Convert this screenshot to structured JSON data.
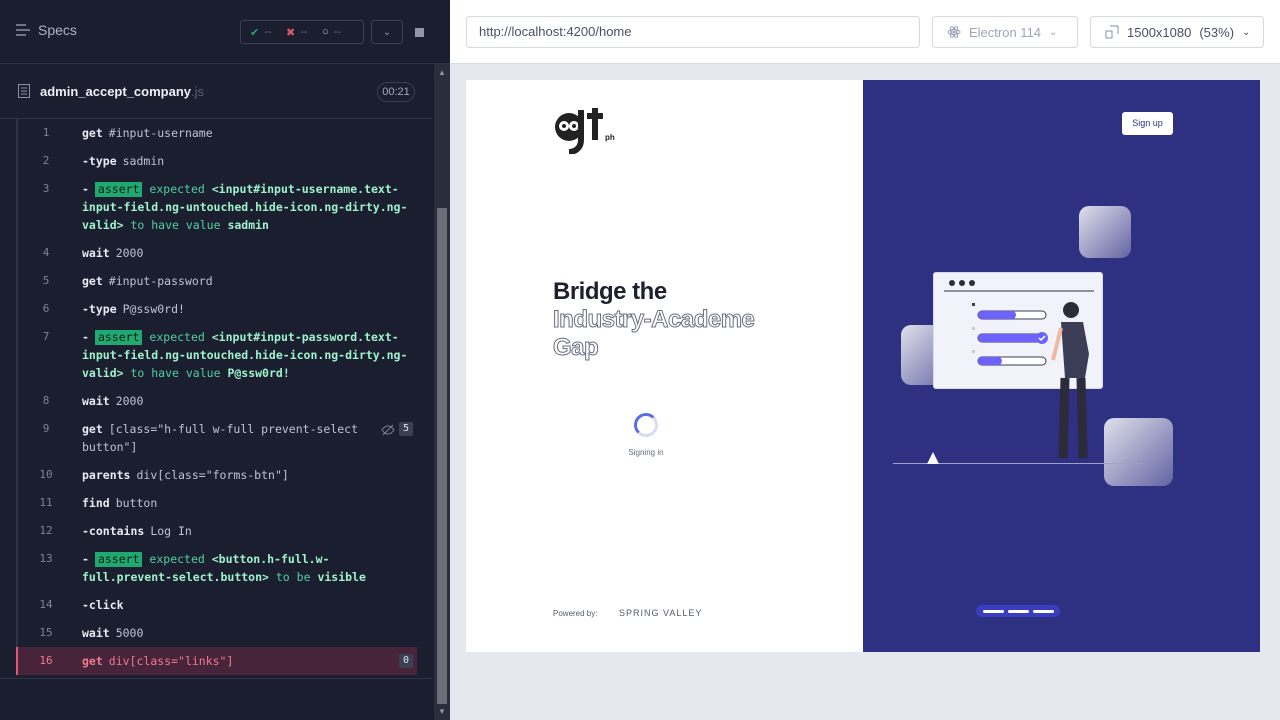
{
  "runner": {
    "specs_label": "Specs",
    "stats": {
      "passed": "--",
      "failed": "--",
      "pending": "--"
    },
    "file": {
      "name": "admin_accept_company",
      "ext": ".js",
      "duration": "00:21"
    },
    "commands": [
      {
        "num": "1",
        "name": "get",
        "msg": "#input-username"
      },
      {
        "num": "2",
        "name": "-type",
        "msg": "sadmin"
      },
      {
        "num": "3",
        "name": "-",
        "badge": "assert",
        "pre": "expected",
        "strong": "<input#input-username.text-input-field.ng-untouched.hide-icon.ng-dirty.ng-valid>",
        "mid": "to have value",
        "val": "sadmin"
      },
      {
        "num": "4",
        "name": "wait",
        "msg": "2000"
      },
      {
        "num": "5",
        "name": "get",
        "msg": "#input-password"
      },
      {
        "num": "6",
        "name": "-type",
        "msg": "P@ssw0rd!"
      },
      {
        "num": "7",
        "name": "-",
        "badge": "assert",
        "pre": "expected",
        "strong": "<input#input-password.text-input-field.ng-untouched.hide-icon.ng-dirty.ng-valid>",
        "mid": "to have value",
        "val": "P@ssw0rd!"
      },
      {
        "num": "8",
        "name": "wait",
        "msg": "2000"
      },
      {
        "num": "9",
        "name": "get",
        "msg": "[class=\"h-full w-full prevent-select button\"]",
        "count": "5"
      },
      {
        "num": "10",
        "name": "parents",
        "msg": "div[class=\"forms-btn\"]"
      },
      {
        "num": "11",
        "name": "find",
        "msg": "button"
      },
      {
        "num": "12",
        "name": "-contains",
        "msg": "Log In"
      },
      {
        "num": "13",
        "name": "-",
        "badge": "assert",
        "pre": "expected",
        "strong": "<button.h-full.w-full.prevent-select.button>",
        "mid": "to be",
        "val": "visible"
      },
      {
        "num": "14",
        "name": "-click",
        "msg": ""
      },
      {
        "num": "15",
        "name": "wait",
        "msg": "5000"
      },
      {
        "num": "16",
        "name": "get",
        "msg": "div[class=\"links\"]",
        "count": "0"
      }
    ]
  },
  "browser": {
    "url": "http://localhost:4200/home",
    "browser_name": "Electron 114",
    "viewport": "1500x1080",
    "scale": "(53%)"
  },
  "app": {
    "logo_text": "jt",
    "logo_sub": "ph",
    "headline_1": "Bridge the",
    "headline_2": "Industry-Academe",
    "headline_3": "Gap",
    "signing_in": "Signing in",
    "powered_by": "Powered by:",
    "brand": "SPRING VALLEY",
    "signup": "Sign up"
  },
  "colors": {
    "panel": "#1b1e2e",
    "pass": "#1fa971",
    "fail": "#e45770",
    "hero": "#2e3082"
  }
}
